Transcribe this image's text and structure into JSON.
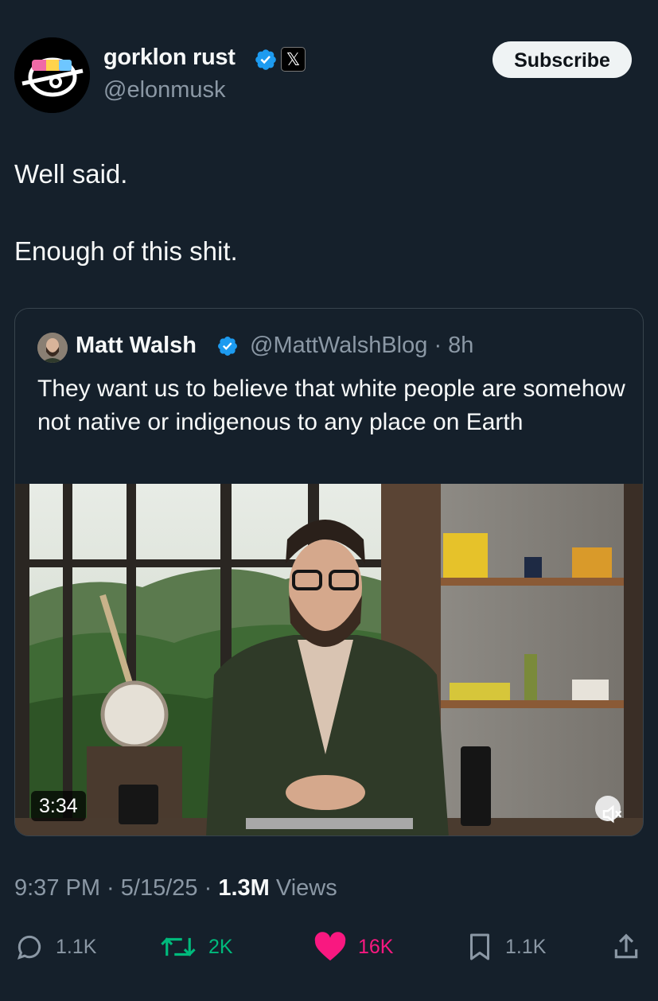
{
  "author": {
    "name": "gorklon rust",
    "handle": "@elonmusk",
    "platform_badge": "𝕏",
    "subscribe_label": "Subscribe"
  },
  "tweet": {
    "lines": [
      "Well said.",
      "Enough of this shit."
    ]
  },
  "quote": {
    "name": "Matt Walsh",
    "handle": "@MattWalshBlog",
    "age": "8h",
    "text": "They want us to believe that white people are somehow not native or indigenous to any place on Earth",
    "video_duration": "3:34"
  },
  "meta": {
    "time": "9:37 PM",
    "date": "5/15/25",
    "views_count": "1.3M",
    "views_label": "Views"
  },
  "actions": {
    "replies": "1.1K",
    "reposts": "2K",
    "likes": "16K",
    "bookmarks": "1.1K"
  },
  "colors": {
    "background": "#15202b",
    "secondary_text": "#8b98a5",
    "verified_blue": "#1d9bf0",
    "repost_green": "#00ba7c",
    "like_pink": "#f91880"
  }
}
